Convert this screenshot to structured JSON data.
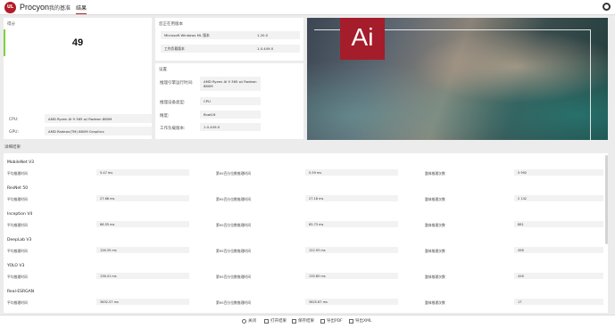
{
  "app": {
    "brand": "Procyon",
    "logo_text": "UL"
  },
  "nav": [
    {
      "label": "我的基准"
    },
    {
      "label": "结果"
    }
  ],
  "score_panel": {
    "label": "得分",
    "score": "49",
    "accent_color": "#7bd13b"
  },
  "hardware": [
    {
      "label": "CPU:",
      "value": "AMD Ryzen AI 9 365 w/ Radeon 880M"
    },
    {
      "label": "GPU:",
      "value": "AMD Radeon(TM) 880M Graphics"
    }
  ],
  "versions": {
    "title": "您正在用版本",
    "rows": [
      {
        "label": "Microsoft Windows ML 版本",
        "value": "1.20.0"
      },
      {
        "label": "工作负载版本",
        "value": "1.0.449.0"
      }
    ]
  },
  "settings": {
    "title": "设置",
    "rows": [
      {
        "label": "推理引擎运行时间:",
        "value": "AMD Ryzen AI 9 365 w/ Radeon 880M"
      },
      {
        "label": "推理设备类型:",
        "value": "CPU"
      },
      {
        "label": "精度:",
        "value": "float16"
      },
      {
        "label": "工作负载版本:",
        "value": "1.0.449.0"
      }
    ]
  },
  "hero": {
    "logo_text": "Ai",
    "brand_color": "#a51c2a"
  },
  "results": {
    "title": "详细结果",
    "col_labels": [
      "平均推理时间",
      "第95百分位数推理时间",
      "整体推理次数"
    ],
    "models": [
      {
        "name": "MobileNet V3",
        "avg": "5.47 ms",
        "p95": "5.59 ms",
        "count": "5 992"
      },
      {
        "name": "ResNet 50",
        "avg": "27.66 ms",
        "p95": "27.18 ms",
        "count": "2 142"
      },
      {
        "name": "Inception V4",
        "avg": "66.55 ms",
        "p95": "65.73 ms",
        "count": "881"
      },
      {
        "name": "DeepLab V3",
        "avg": "126.35 ms",
        "p95": "122.93 ms",
        "count": "458"
      },
      {
        "name": "YOLO V3",
        "avg": "136.41 ms",
        "p95": "135.65 ms",
        "count": "426"
      },
      {
        "name": "Real-ESRGAN",
        "avg": "3632.57 ms",
        "p95": "3625.67 ms",
        "count": "17"
      }
    ]
  },
  "bottom": [
    {
      "label": "关闭"
    },
    {
      "label": "打开结果"
    },
    {
      "label": "保存结果"
    },
    {
      "label": "导出PDF"
    },
    {
      "label": "导出XML"
    }
  ]
}
